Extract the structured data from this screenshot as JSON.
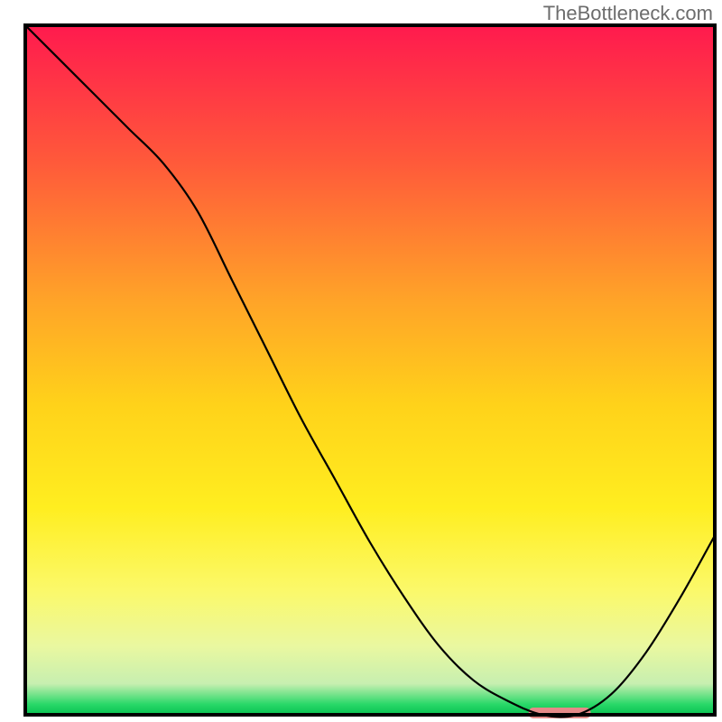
{
  "watermark": "TheBottleneck.com",
  "chart_data": {
    "type": "line",
    "title": "",
    "xlabel": "",
    "ylabel": "",
    "xlim": [
      0,
      100
    ],
    "ylim": [
      0,
      100
    ],
    "x": [
      0,
      5,
      10,
      15,
      20,
      25,
      30,
      35,
      40,
      45,
      50,
      55,
      60,
      65,
      70,
      75,
      80,
      85,
      90,
      95,
      100
    ],
    "values": [
      100,
      95,
      90,
      85,
      80,
      73,
      63,
      53,
      43,
      34,
      25,
      17,
      10,
      5,
      2,
      0,
      0,
      3,
      9,
      17,
      26
    ],
    "marker_region": {
      "x_start": 73,
      "x_end": 82,
      "y": 0
    },
    "background": {
      "type": "vertical_gradient_rainbow_with_green_band",
      "stops": [
        {
          "offset": 0.0,
          "color": "#ff1a4e"
        },
        {
          "offset": 0.2,
          "color": "#ff5a3a"
        },
        {
          "offset": 0.4,
          "color": "#ffa428"
        },
        {
          "offset": 0.55,
          "color": "#ffd21a"
        },
        {
          "offset": 0.7,
          "color": "#ffee20"
        },
        {
          "offset": 0.82,
          "color": "#fbf96a"
        },
        {
          "offset": 0.9,
          "color": "#eaf8a0"
        },
        {
          "offset": 0.955,
          "color": "#c7efb0"
        },
        {
          "offset": 0.985,
          "color": "#28d868"
        },
        {
          "offset": 1.0,
          "color": "#08c050"
        }
      ]
    },
    "marker_color": "#e58a88",
    "line_color": "#000000",
    "frame_color": "#000000"
  }
}
